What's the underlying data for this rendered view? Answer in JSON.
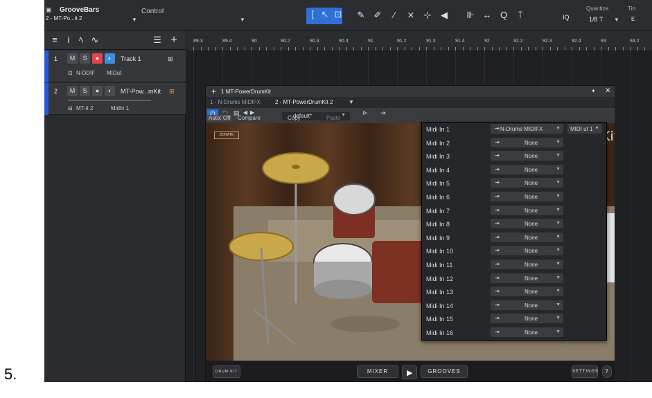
{
  "step_label": "5.",
  "close_mark": "X",
  "topbar": {
    "song_title": "GrooveBars",
    "song_sub": "2 - MT-Po...it 2",
    "control_label": "Control",
    "quantize_label": "Quantize",
    "quantize_value": "1/8 T",
    "iq_label": "IQ",
    "timebase_label": "Tin",
    "timebase_sub": "E"
  },
  "ruler": {
    "marks": [
      "89.3",
      "89.4",
      "90",
      "90.2",
      "90.3",
      "90.4",
      "91",
      "91.2",
      "91.3",
      "91.4",
      "92",
      "92.2",
      "92.3",
      "92.4",
      "93",
      "93.2"
    ]
  },
  "tracks": [
    {
      "number": "1",
      "mute": "M",
      "solo": "S",
      "name": "Track 1",
      "input": "N-DDIF",
      "output": "MIDut"
    },
    {
      "number": "2",
      "mute": "M",
      "solo": "S",
      "name": "MT-Pow...mKit",
      "input": "MT-it 2",
      "output": "MidIn 1"
    }
  ],
  "plugin": {
    "title": "1 MT-PowerDrumKit",
    "tabs": [
      "1 - N-Drums MIDIFX",
      "2 - MT-PowerDrumKit 2"
    ],
    "preset": "default*",
    "auto_off": "Auto: Off",
    "compare": "Compare",
    "copy": "Copy",
    "paste": "Paste",
    "donate": "DONATE",
    "brand": "DrumKit 2",
    "drum_kit": "DRUM KIT",
    "mixer": "MIXER",
    "grooves": "GROOVES",
    "settings": "SETTINGS",
    "help": "?"
  },
  "midi_menu": {
    "rows": [
      {
        "label": "Midi In 1",
        "value": "N-Drums MIDIFX",
        "extra": "MIDI ut 1"
      },
      {
        "label": "Midi In 2",
        "value": "None"
      },
      {
        "label": "Midi In 3",
        "value": "None"
      },
      {
        "label": "Midi In 4",
        "value": "None"
      },
      {
        "label": "Midi In 5",
        "value": "None"
      },
      {
        "label": "Midi In 6",
        "value": "None"
      },
      {
        "label": "Midi In 7",
        "value": "None"
      },
      {
        "label": "Midi In 8",
        "value": "None"
      },
      {
        "label": "Midi In 9",
        "value": "None"
      },
      {
        "label": "Midi In 10",
        "value": "None"
      },
      {
        "label": "Midi In 11",
        "value": "None"
      },
      {
        "label": "Midi In 12",
        "value": "None"
      },
      {
        "label": "Midi In 13",
        "value": "None"
      },
      {
        "label": "Midi In 14",
        "value": "None"
      },
      {
        "label": "Midi In 15",
        "value": "None"
      },
      {
        "label": "Midi In 16",
        "value": "None"
      }
    ]
  },
  "colors": {
    "accent": "#2e6fd8",
    "record": "#e8424a",
    "monitor": "#3f8fe0",
    "track_stripe": "#2a57e0"
  }
}
